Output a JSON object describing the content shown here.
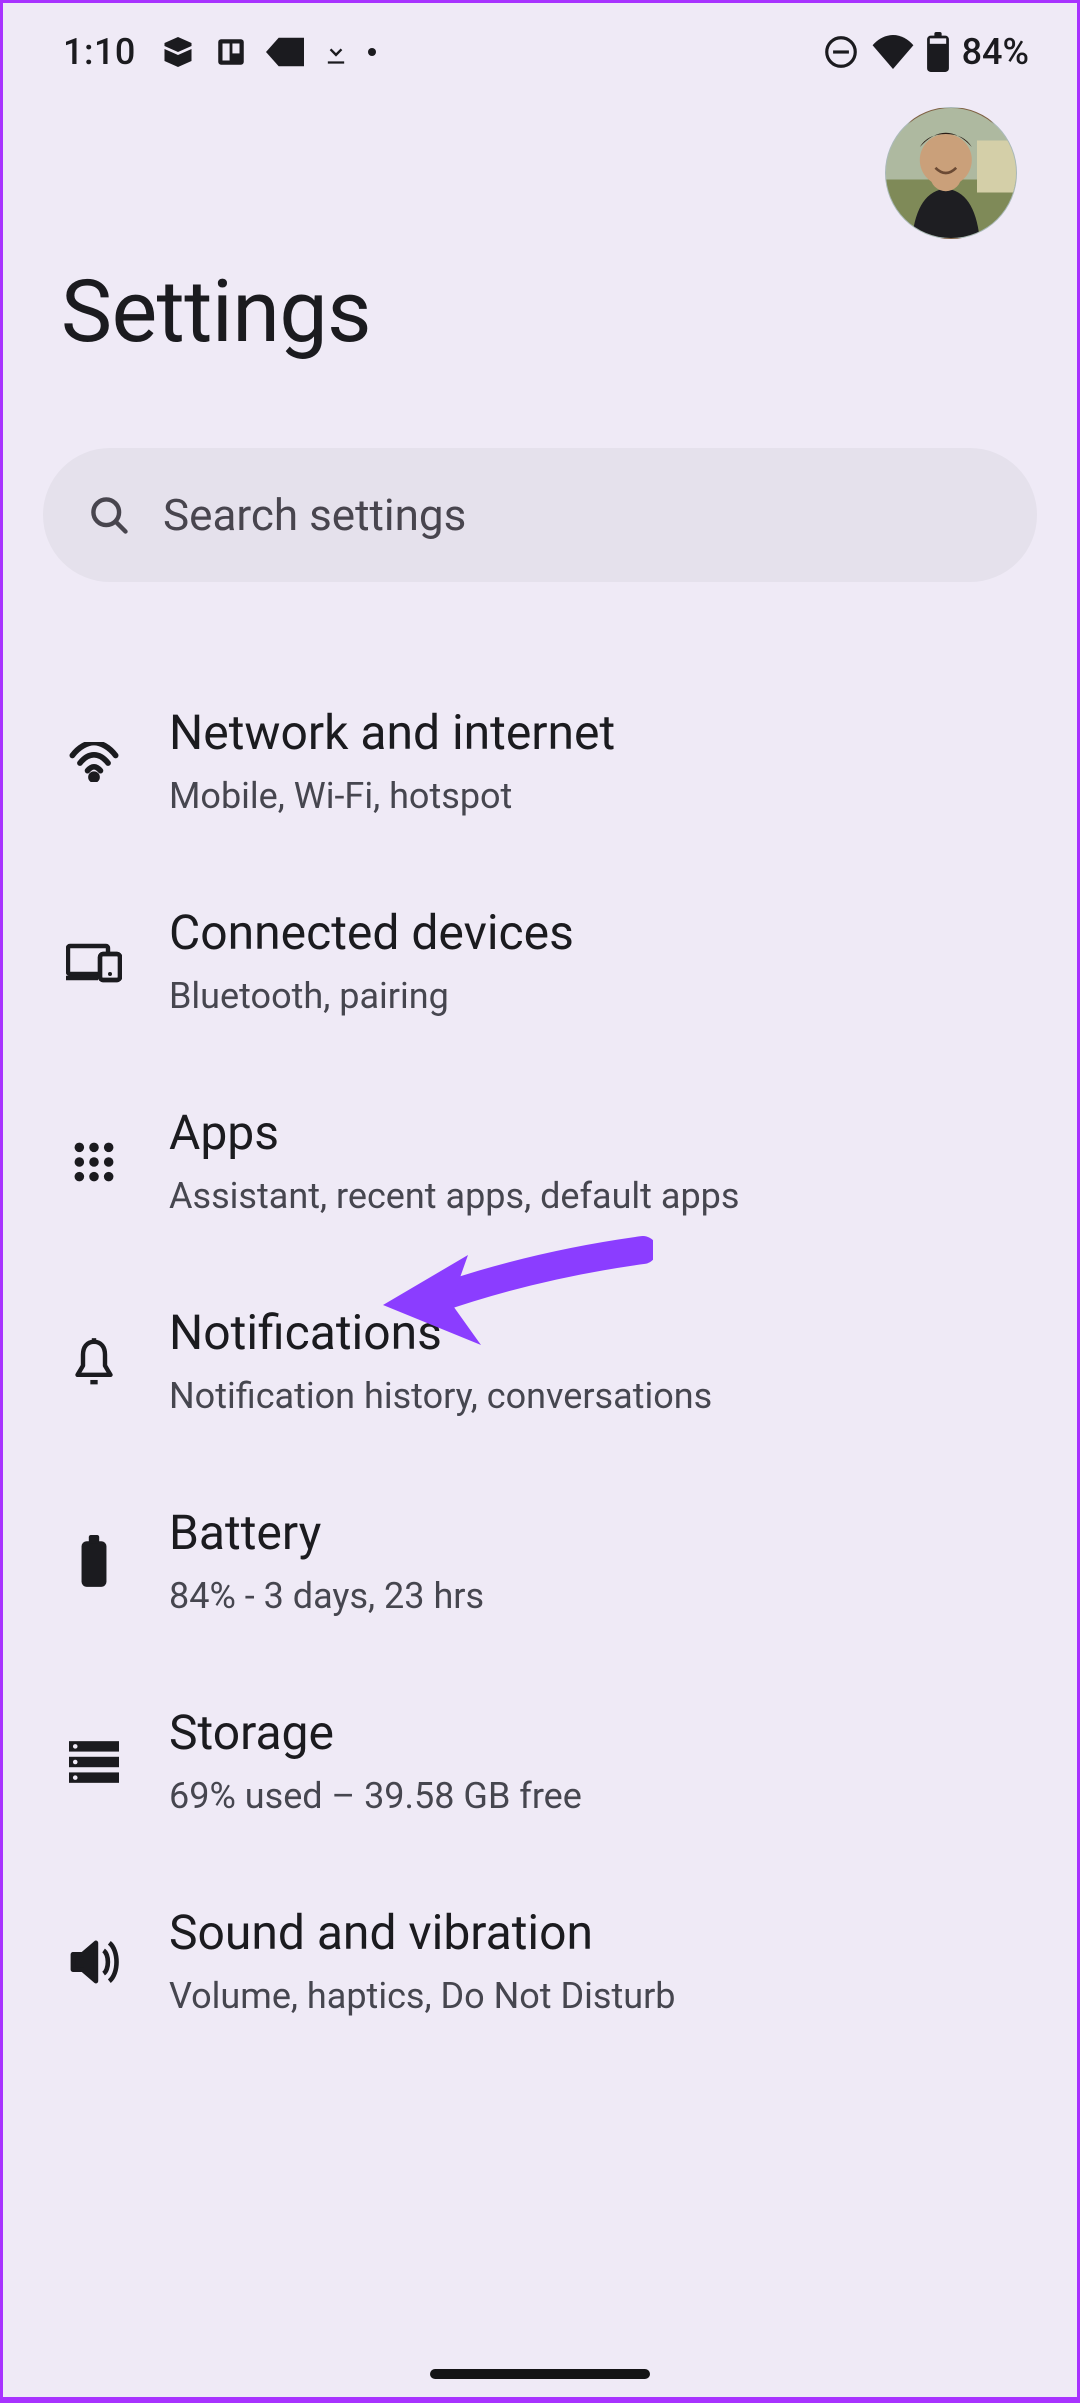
{
  "status": {
    "time": "1:10",
    "battery_pct": "84%"
  },
  "header": {
    "title": "Settings"
  },
  "search": {
    "placeholder": "Search settings"
  },
  "items": [
    {
      "title": "Network and internet",
      "subtitle": "Mobile, Wi-Fi, hotspot"
    },
    {
      "title": "Connected devices",
      "subtitle": "Bluetooth, pairing"
    },
    {
      "title": "Apps",
      "subtitle": "Assistant, recent apps, default apps"
    },
    {
      "title": "Notifications",
      "subtitle": "Notification history, conversations"
    },
    {
      "title": "Battery",
      "subtitle": "84% - 3 days, 23 hrs"
    },
    {
      "title": "Storage",
      "subtitle": "69% used – 39.58 GB free"
    },
    {
      "title": "Sound and vibration",
      "subtitle": "Volume, haptics, Do Not Disturb"
    }
  ],
  "annotation": {
    "points_to_item_index": 2,
    "color": "#8b3dff"
  }
}
